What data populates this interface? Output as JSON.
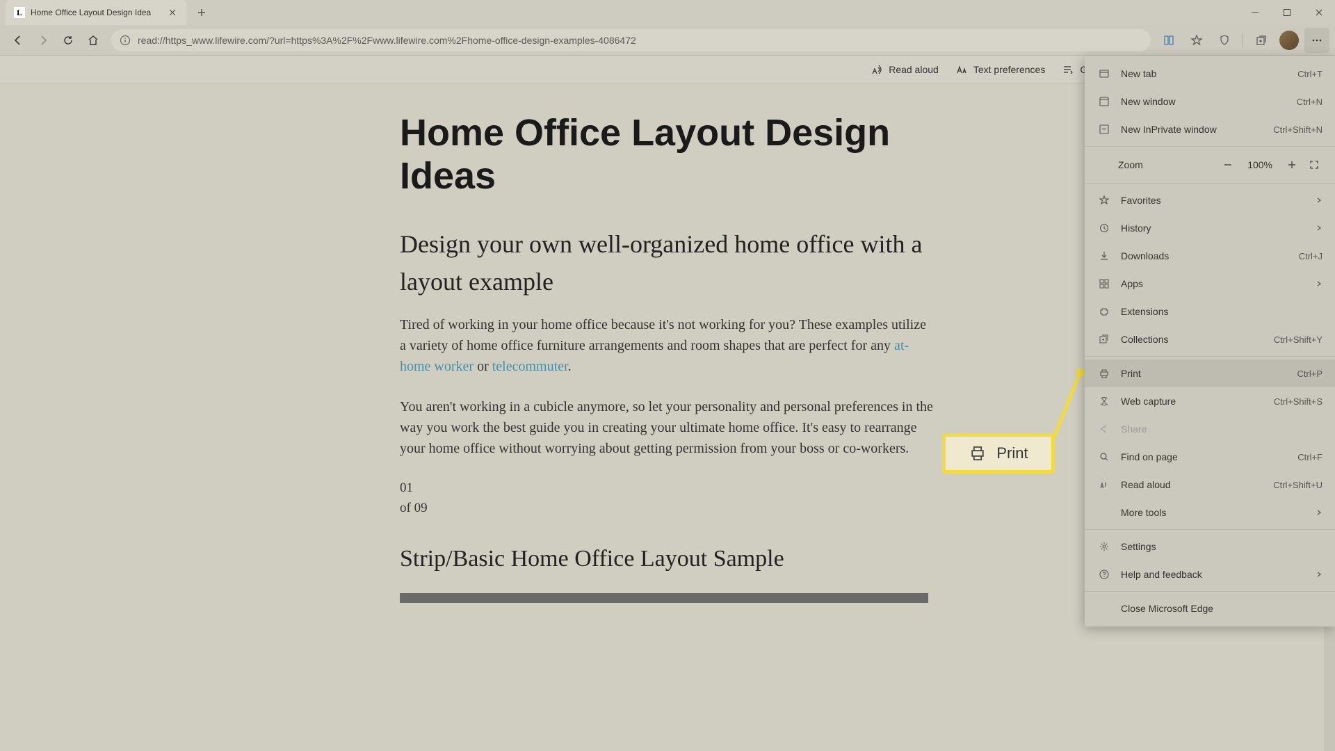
{
  "tab": {
    "favicon_letter": "L",
    "title": "Home Office Layout Design Idea"
  },
  "address": {
    "url": "read://https_www.lifewire.com/?url=https%3A%2F%2Fwww.lifewire.com%2Fhome-office-design-examples-4086472"
  },
  "reader": {
    "read_aloud": "Read aloud",
    "text_prefs": "Text preferences",
    "grammar": "Gramm"
  },
  "article": {
    "h1": "Home Office Layout Design Ideas",
    "h2": "Design your own well-organized home office with a layout example",
    "p1a": "Tired of working in your home office because it's not working for you? These examples utilize a variety of home office furniture arrangements and room shapes that are perfect for any ",
    "link1": "at-home worker",
    "p1b": " or ",
    "link2": "telecommuter",
    "p1c": ".",
    "p2": "You aren't working in a cubicle anymore, so let your personality and personal preferences in the way you work the best guide you in creating your ultimate home office. It's easy to rearrange your home office without worrying about getting permission from your boss or co-workers.",
    "counter_a": "01",
    "counter_b": "of 09",
    "h3": "Strip/Basic Home Office Layout Sample"
  },
  "callout": {
    "label": "Print"
  },
  "menu": {
    "new_tab": "New tab",
    "new_tab_sc": "Ctrl+T",
    "new_window": "New window",
    "new_window_sc": "Ctrl+N",
    "new_inprivate": "New InPrivate window",
    "new_inprivate_sc": "Ctrl+Shift+N",
    "zoom_label": "Zoom",
    "zoom_value": "100%",
    "favorites": "Favorites",
    "history": "History",
    "downloads": "Downloads",
    "downloads_sc": "Ctrl+J",
    "apps": "Apps",
    "extensions": "Extensions",
    "collections": "Collections",
    "collections_sc": "Ctrl+Shift+Y",
    "print": "Print",
    "print_sc": "Ctrl+P",
    "web_capture": "Web capture",
    "web_capture_sc": "Ctrl+Shift+S",
    "share": "Share",
    "find": "Find on page",
    "find_sc": "Ctrl+F",
    "read_aloud": "Read aloud",
    "read_aloud_sc": "Ctrl+Shift+U",
    "more_tools": "More tools",
    "settings": "Settings",
    "help": "Help and feedback",
    "close_edge": "Close Microsoft Edge"
  }
}
